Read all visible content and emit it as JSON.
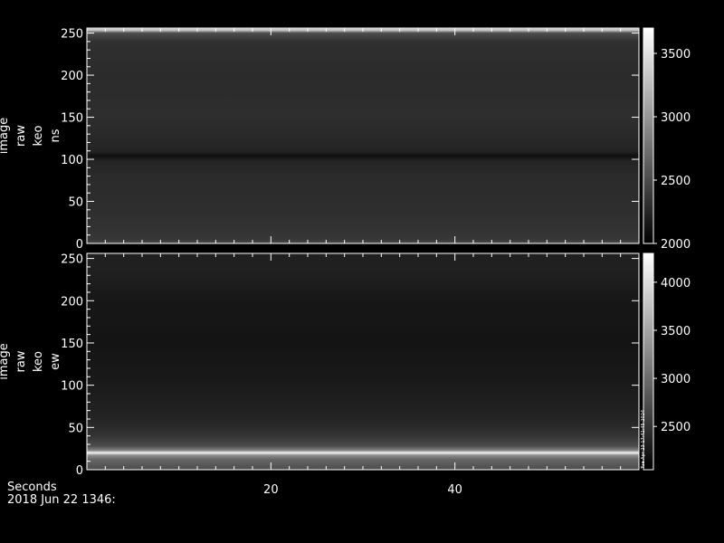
{
  "footer": {
    "x_axis_label": "Seconds",
    "timestamp": "2018 Jun 22 1346:"
  },
  "side_note": "Tue Apr 23 17:42:45 2024",
  "chart_data": [
    {
      "type": "heatmap",
      "ylabel": [
        "image",
        "raw",
        "keo",
        "ns"
      ],
      "xlim": [
        0,
        60
      ],
      "ylim": [
        0,
        256
      ],
      "xticks": [
        20,
        40
      ],
      "yticks": [
        0,
        50,
        100,
        150,
        200,
        250
      ],
      "colorbar": {
        "range": [
          2000,
          3700
        ],
        "ticks": [
          2000,
          2500,
          3000,
          3500
        ]
      },
      "profile": [
        [
          0,
          0.3
        ],
        [
          4,
          0.22
        ],
        [
          15,
          0.2
        ],
        [
          40,
          0.18
        ],
        [
          80,
          0.17
        ],
        [
          98,
          0.14
        ],
        [
          104,
          0.06
        ],
        [
          110,
          0.14
        ],
        [
          150,
          0.18
        ],
        [
          200,
          0.17
        ],
        [
          240,
          0.19
        ],
        [
          250,
          0.3
        ],
        [
          254,
          0.85
        ],
        [
          256,
          0.55
        ]
      ]
    },
    {
      "type": "heatmap",
      "ylabel": [
        "image",
        "raw",
        "keo",
        "ew"
      ],
      "xlim": [
        0,
        60
      ],
      "ylim": [
        0,
        256
      ],
      "xticks": [
        20,
        40
      ],
      "yticks": [
        0,
        50,
        100,
        150,
        200,
        250
      ],
      "colorbar": {
        "range": [
          2050,
          4300
        ],
        "ticks": [
          2500,
          3000,
          3500,
          4000
        ]
      },
      "profile": [
        [
          0,
          0.3
        ],
        [
          6,
          0.35
        ],
        [
          12,
          0.4
        ],
        [
          17,
          0.55
        ],
        [
          20,
          0.95
        ],
        [
          23,
          0.5
        ],
        [
          28,
          0.3
        ],
        [
          40,
          0.2
        ],
        [
          60,
          0.14
        ],
        [
          100,
          0.1
        ],
        [
          150,
          0.08
        ],
        [
          200,
          0.09
        ],
        [
          230,
          0.12
        ],
        [
          245,
          0.13
        ],
        [
          256,
          0.12
        ]
      ]
    }
  ]
}
